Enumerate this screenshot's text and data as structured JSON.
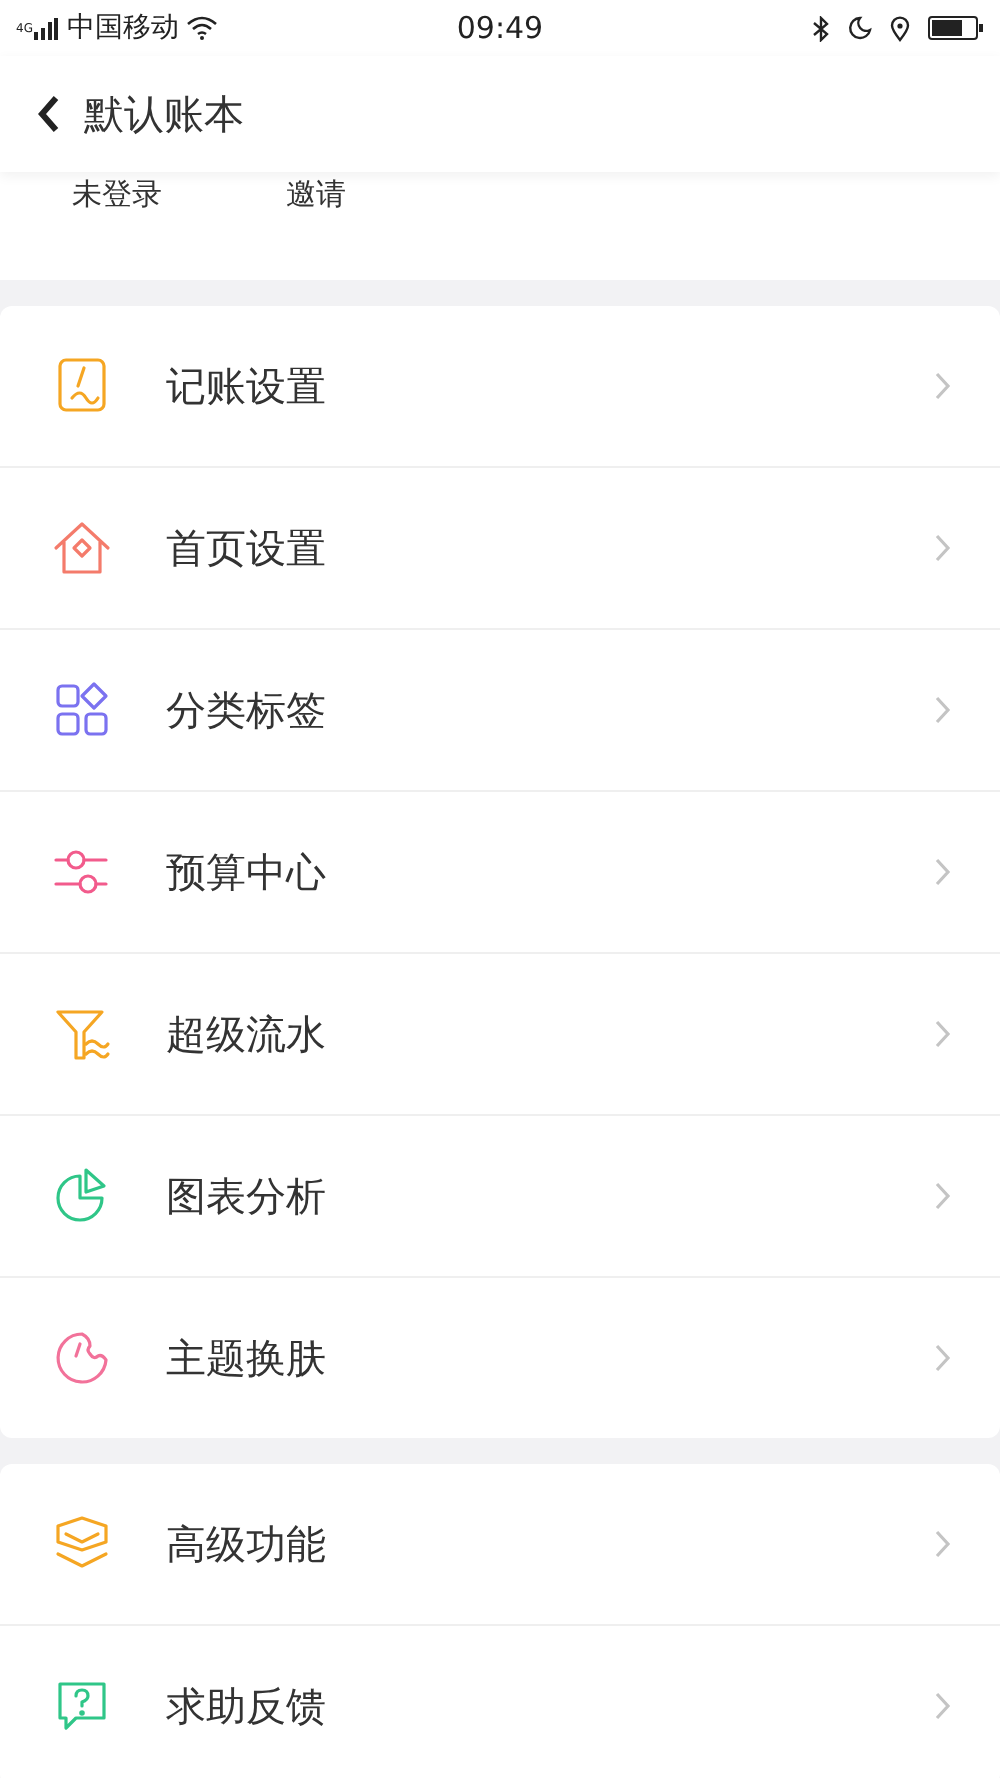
{
  "status_bar": {
    "network": "4G",
    "carrier": "中国移动",
    "time": "09:49"
  },
  "nav_bar": {
    "title": "默认账本"
  },
  "account_row": {
    "login": "未登录",
    "invite": "邀请"
  },
  "menu_groups": [
    {
      "items": [
        {
          "label": "记账设置"
        },
        {
          "label": "首页设置"
        },
        {
          "label": "分类标签"
        },
        {
          "label": "预算中心"
        },
        {
          "label": "超级流水"
        },
        {
          "label": "图表分析"
        },
        {
          "label": "主题换肤"
        }
      ]
    },
    {
      "items": [
        {
          "label": "高级功能"
        },
        {
          "label": "求助反馈"
        }
      ]
    }
  ]
}
